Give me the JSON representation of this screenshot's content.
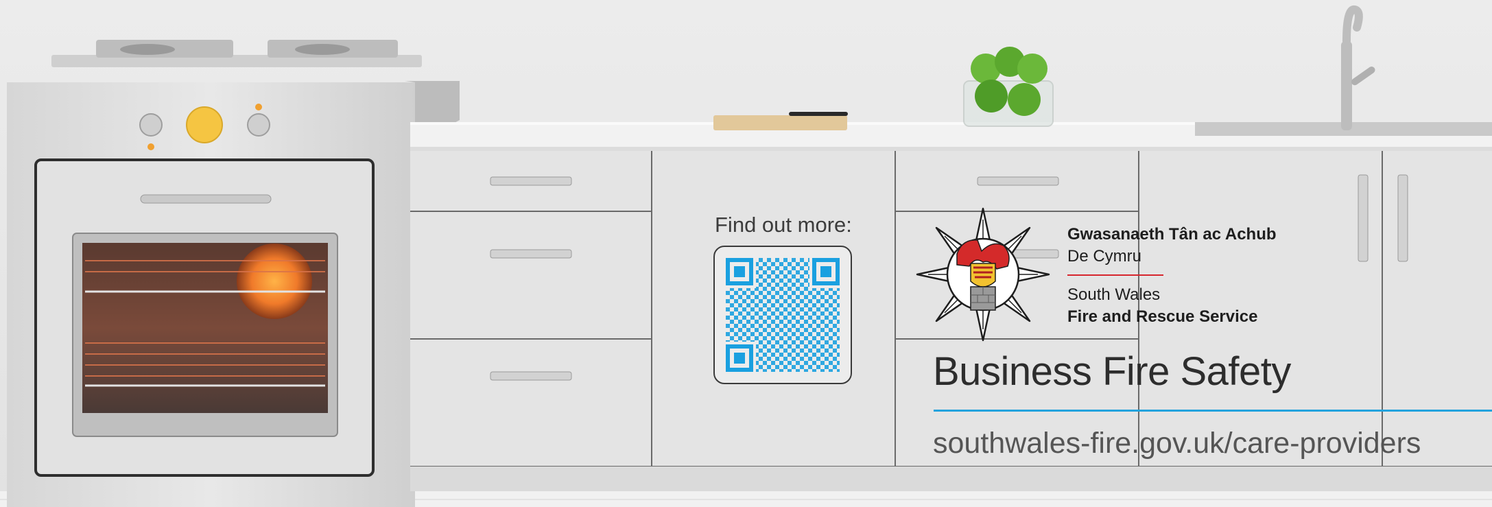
{
  "qr_section": {
    "heading": "Find out more:"
  },
  "organisation": {
    "welsh_name_line1": "Gwasanaeth Tân ac Achub",
    "welsh_name_line2": "De Cymru",
    "english_name_line1": "South Wales",
    "english_name_line2": "Fire and Rescue Service",
    "logo_icon": "fire-service-crest-icon",
    "divider_color": "#d7262e"
  },
  "poster": {
    "title": "Business Fire Safety",
    "url": "southwales-fire.gov.uk/care-providers",
    "accent_color": "#23a3dd"
  }
}
